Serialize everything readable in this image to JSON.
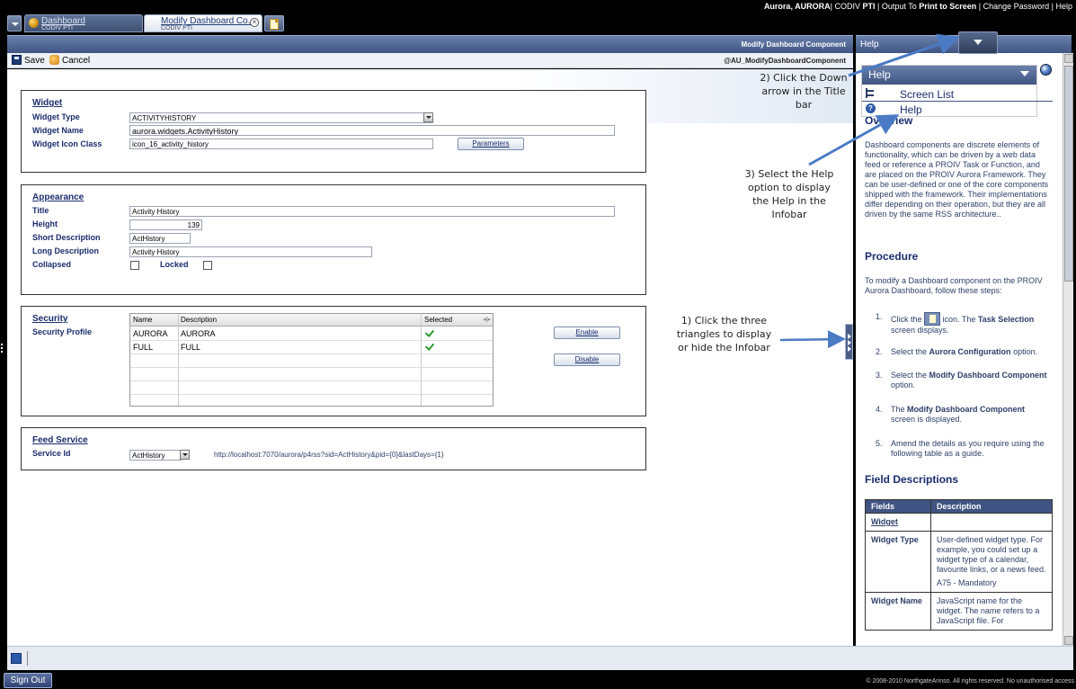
{
  "user_bar": {
    "user": "Aurora, AURORA",
    "instance": "CODIV",
    "instance_suffix": "PTI",
    "output_label": "Output To",
    "output_target": "Print to Screen",
    "change_password": "Change Password",
    "help": "Help"
  },
  "tabs": [
    {
      "title": "Dashboard",
      "subtitle": "CODIV PTI"
    },
    {
      "title": "Modify Dashboard Co...",
      "subtitle": "CODIV PTI"
    }
  ],
  "title_bar": {
    "page_title": "Modify Dashboard Component"
  },
  "toolbar": {
    "save_label": "Save",
    "cancel_label": "Cancel",
    "component_id": "@AU_ModifyDashboardComponent"
  },
  "widget": {
    "section_title": "Widget",
    "type_label": "Widget Type",
    "type_value": "ACTIVITYHISTORY",
    "name_label": "Widget Name",
    "name_value": "aurora.widgets.ActivityHistory",
    "icon_label": "Widget Icon Class",
    "icon_value": "icon_16_activity_history",
    "parameters_button": "Parameters"
  },
  "appearance": {
    "section_title": "Appearance",
    "title_label": "Title",
    "title_value": "Activity History",
    "height_label": "Height",
    "height_value": "139",
    "short_label": "Short Description",
    "short_value": "ActHistory",
    "long_label": "Long Description",
    "long_value": "Activity History",
    "collapsed_label": "Collapsed",
    "locked_label": "Locked"
  },
  "security": {
    "section_title": "Security",
    "profile_label": "Security Profile",
    "columns": [
      "Name",
      "Description",
      "Selected"
    ],
    "rows": [
      {
        "name": "AURORA",
        "description": "AURORA",
        "selected": true
      },
      {
        "name": "FULL",
        "description": "FULL",
        "selected": true
      }
    ],
    "enable_button": "Enable",
    "disable_button": "Disable"
  },
  "feed": {
    "section_title": "Feed Service",
    "service_label": "Service Id",
    "service_value": "ActHistory",
    "url": "http://localhost:7070/aurora/p4rss?sid=ActHistory&pid={0}&lastDays={1}"
  },
  "footer": {
    "sign_out": "Sign Out",
    "copyright": "© 2008-2010 NorthgateArinso. All rights reserved. No unauthorised access"
  },
  "help_panel": {
    "title": "Help",
    "menu_title": "Help",
    "menu_items": [
      {
        "label": "Screen List",
        "icon": "sitemap-icon"
      },
      {
        "label": "Help",
        "icon": "help-icon"
      }
    ],
    "overview_heading": "Overview",
    "overview_text": "Dashboard components are discrete elements of functionality, which can be driven by a web data feed or reference a PROIV Task or Function, and are placed on the PROIV Aurora Framework. They can be user-defined or one of the core components shipped with the framework. Their implementations differ depending on their operation, but they are all driven by the same RSS architecture..",
    "procedure_heading": "Procedure",
    "procedure_text": "To modify a Dashboard component on the PROIV Aurora Dashboard, follow these steps:",
    "steps": [
      {
        "n": "1.",
        "pre": "Click the",
        "post": "icon. The",
        "bold": "Task Selection",
        "tail": "screen displays."
      },
      {
        "n": "2.",
        "pre": "Select the",
        "bold": "Aurora Configuration",
        "tail": "option."
      },
      {
        "n": "3.",
        "pre": "Select the",
        "bold": "Modify Dashboard Component",
        "tail": "option."
      },
      {
        "n": "4.",
        "pre": "The",
        "bold": "Modify Dashboard Component",
        "tail": "screen is displayed."
      },
      {
        "n": "5.",
        "pre": "Amend the details as you require using the following table as a guide."
      }
    ],
    "field_heading": "Field Descriptions",
    "table_headers": [
      "Fields",
      "Description"
    ],
    "table_rows": [
      {
        "field": "Widget",
        "desc": "",
        "is_link": true
      },
      {
        "field": "Widget Type",
        "desc": "User-defined widget type. For example, you could set up a widget type of a calendar, favourite links, or a news feed.",
        "note": "A75 - Mandatory"
      },
      {
        "field": "Widget Name",
        "desc": "JavaScript name for the widget. The name refers to a JavaScript file. For"
      }
    ]
  },
  "annotations": {
    "a1": "1) Click the three triangles to display or hide the Infobar",
    "a2": "2) Click the Down arrow in the Title bar",
    "a3": "3) Select the Help option to display the Help in the Infobar"
  },
  "colors": {
    "accent": "#3f5482",
    "link": "#1a2e6e",
    "arrow": "#4a7bc4"
  }
}
